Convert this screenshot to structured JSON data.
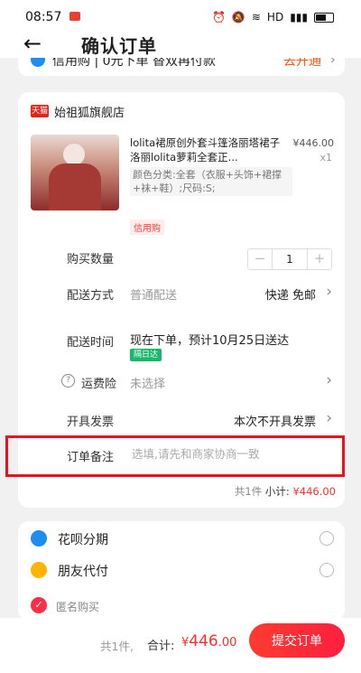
{
  "status_bar": {
    "time": "08:57",
    "network": "HD"
  },
  "header": {
    "title": "确认订单"
  },
  "promo": {
    "text": "信用购 | 0元下单 替双再付款",
    "link": "去开通"
  },
  "shop": {
    "badge": "天猫",
    "name": "始祖狐旗舰店"
  },
  "product": {
    "title": "lolita裙原创外套斗篷洛丽塔裙子洛丽lolita萝莉全套正...",
    "price": "¥446.00",
    "quantity": "x1",
    "spec": "颜色分类:全套（衣服+头饰+裙撑+袜+鞋）;尺码:S;",
    "tag": "信用购"
  },
  "rows": {
    "quantity_label": "购买数量",
    "quantity_value": "1",
    "shipping_label": "配送方式",
    "shipping_value": "普通配送",
    "shipping_right": "快递 免邮",
    "delivery_label": "配送时间",
    "delivery_value": "现在下单，预计10月25日送达",
    "delivery_tag": "隔日达",
    "insurance_label": "运费险",
    "insurance_value": "未选择",
    "invoice_label": "开具发票",
    "invoice_value": "本次不开具发票",
    "remark_label": "订单备注",
    "remark_placeholder": "选填,请先和商家协商一致"
  },
  "subtotal": {
    "count": "共1件",
    "label": "小计:",
    "amount": "¥446.00"
  },
  "payment": {
    "options": [
      {
        "label": "花呗分期",
        "icon": "huabei-icon"
      },
      {
        "label": "朋友代付",
        "icon": "friend-pay-icon"
      }
    ],
    "anonymous": "匿名购买"
  },
  "bottom": {
    "count": "共1件,",
    "total_label": "合计:",
    "total_symbol": "¥",
    "total_int": "446",
    "total_dec": ".00",
    "submit": "提交订单"
  },
  "colors": {
    "accent": "#ff2d2d",
    "highlight_box": "#e8131f"
  }
}
